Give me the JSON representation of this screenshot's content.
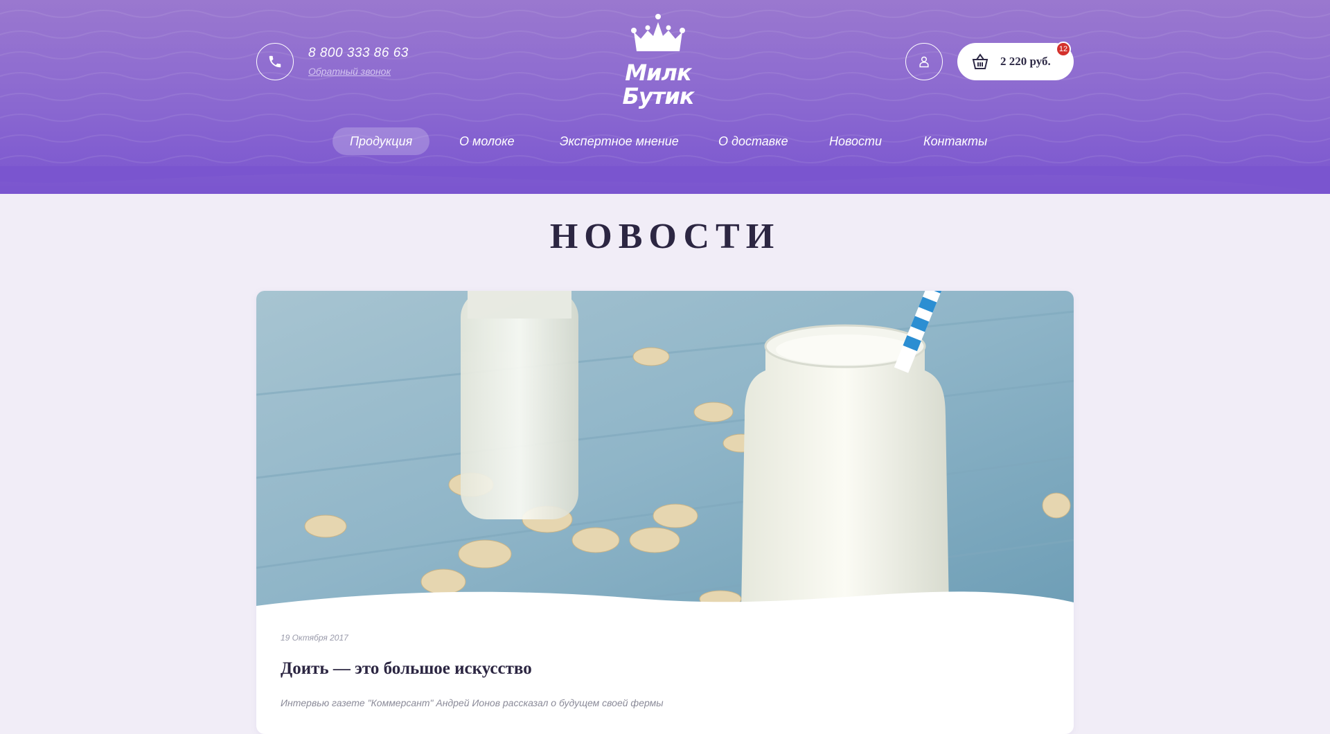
{
  "header": {
    "phone": "8 800 333 86 63",
    "callback_label": "Обратный звонок",
    "logo_line1": "Милк",
    "logo_line2": "Бутик",
    "cart_total": "2 220 руб.",
    "cart_count": "12",
    "icons": {
      "phone": "phone-icon",
      "user": "user-icon",
      "cart": "basket-icon",
      "logo": "crown-icon"
    }
  },
  "nav": {
    "items": [
      {
        "label": "Продукция",
        "active": true
      },
      {
        "label": "О молоке"
      },
      {
        "label": "Экспертное мнение"
      },
      {
        "label": "О доставке"
      },
      {
        "label": "Новости"
      },
      {
        "label": "Контакты"
      }
    ]
  },
  "page": {
    "title": "НОВОСТИ"
  },
  "news": [
    {
      "date": "19 Октября 2017",
      "title": "Доить — это большое искусство",
      "excerpt": "Интервью газете \"Коммерсант\" Андрей Ионов рассказал о будущем своей фермы"
    }
  ],
  "colors": {
    "header_purple": "#8a68d0",
    "page_bg": "#f1edf7",
    "badge_red": "#d3312c",
    "title_dark": "#2c2642"
  }
}
